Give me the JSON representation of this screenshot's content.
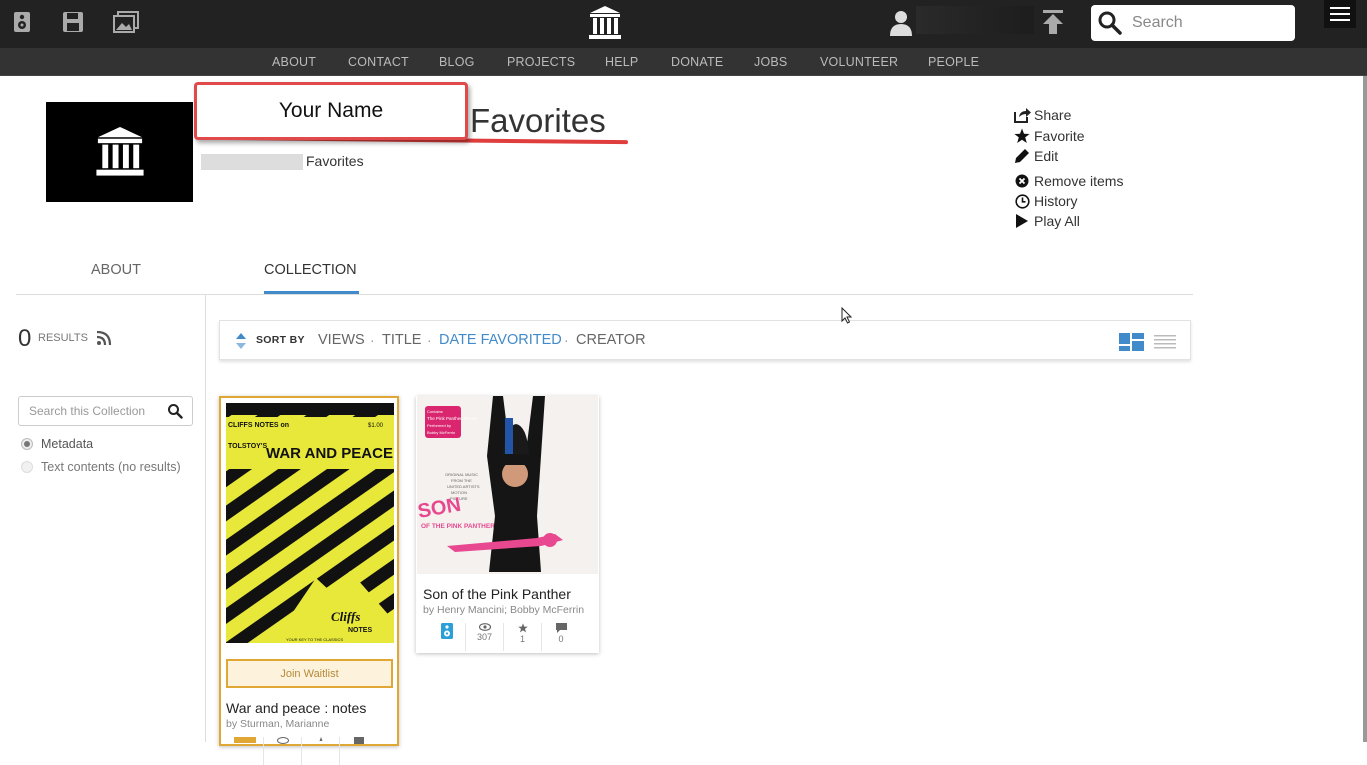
{
  "topbar": {
    "search_placeholder": "Search",
    "icons": [
      "audio-icon",
      "floppy-icon",
      "images-icon",
      "archive-logo-icon",
      "user-icon",
      "upload-icon",
      "search-icon",
      "hamburger-icon"
    ]
  },
  "nav": {
    "items": [
      "ABOUT",
      "CONTACT",
      "BLOG",
      "PROJECTS",
      "HELP",
      "DONATE",
      "JOBS",
      "VOLUNTEER",
      "PEOPLE"
    ]
  },
  "collection": {
    "title": "Favorites",
    "name_box": "Your Name",
    "subtitle": "Favorites"
  },
  "actions": {
    "share": "Share",
    "favorite": "Favorite",
    "edit": "Edit",
    "remove": "Remove items",
    "history": "History",
    "play_all": "Play All"
  },
  "tabs": {
    "about": "ABOUT",
    "collection": "COLLECTION"
  },
  "sidebar": {
    "results_count": "0",
    "results_label": "RESULTS",
    "search_placeholder": "Search this Collection",
    "radio_metadata": "Metadata",
    "radio_text": "Text contents (no results)"
  },
  "sortbar": {
    "label": "SORT BY",
    "options": [
      "VIEWS",
      "TITLE",
      "DATE FAVORITED",
      "CREATOR"
    ],
    "active": "DATE FAVORITED"
  },
  "items": [
    {
      "title": "War and peace : notes",
      "by": "by Sturman, Marianne",
      "button": "Join Waitlist",
      "cover_lines": [
        "CLIFFS NOTES on",
        "$1.00",
        "TOLSTOY'S",
        "WAR AND PEACE",
        "Cliffs",
        "NOTES",
        "YOUR KEY TO THE CLASSICS"
      ]
    },
    {
      "title": "Son of the Pink Panther",
      "by": "by Henry Mancini; Bobby McFerrin",
      "views": "307",
      "favorites": "1",
      "reviews": "0",
      "cover_lines": [
        "Contains",
        "The Pink Panther Theme",
        "Performed by",
        "Bobby McFerrin",
        "ORIGINAL MUSIC",
        "FROM THE",
        "UNITED ARTISTS",
        "MOTION",
        "PICTURE",
        "SON",
        "OF THE PINK PANTHER"
      ]
    }
  ],
  "colors": {
    "accent": "#428bca",
    "waitlist_border": "#e0a735",
    "annotation_red": "#e04a4a",
    "topbar": "#222222"
  }
}
